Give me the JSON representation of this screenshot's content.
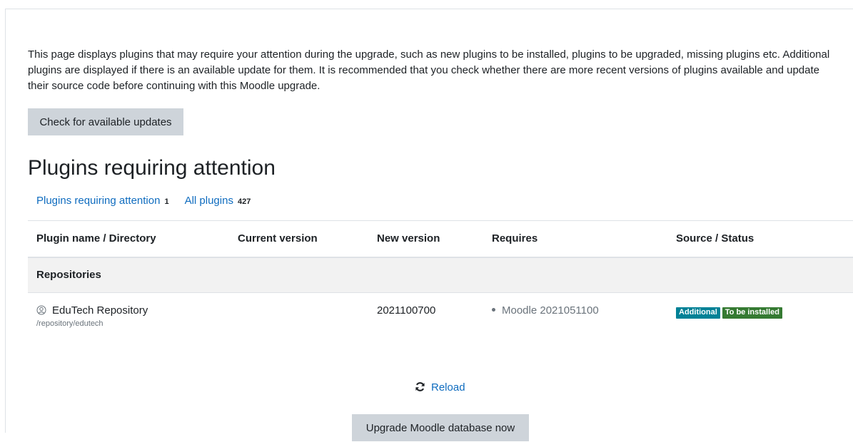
{
  "intro_text": "This page displays plugins that may require your attention during the upgrade, such as new plugins to be installed, plugins to be upgraded, missing plugins etc. Additional plugins are displayed if there is an available update for them. It is recommended that you check whether there are more recent versions of plugins available and update their source code before continuing with this Moodle upgrade.",
  "check_updates_label": "Check for available updates",
  "page_title": "Plugins requiring attention",
  "filters": [
    {
      "label": "Plugins requiring attention",
      "count": "1"
    },
    {
      "label": "All plugins",
      "count": "427"
    }
  ],
  "table": {
    "headers": [
      "Plugin name / Directory",
      "Current version",
      "New version",
      "Requires",
      "Source / Status"
    ],
    "group": "Repositories",
    "rows": [
      {
        "icon": "repository-icon",
        "name": "EduTech Repository",
        "directory": "/repository/edutech",
        "current_version": "",
        "new_version": "2021100700",
        "requires": "Moodle 2021051100",
        "source": "Additional",
        "status": "To be installed"
      }
    ]
  },
  "reload_label": "Reload",
  "upgrade_label": "Upgrade Moodle database now",
  "colors": {
    "link": "#0f6cbf",
    "button": "#ced4da",
    "badge_info": "#008196",
    "badge_success": "#357a32"
  }
}
